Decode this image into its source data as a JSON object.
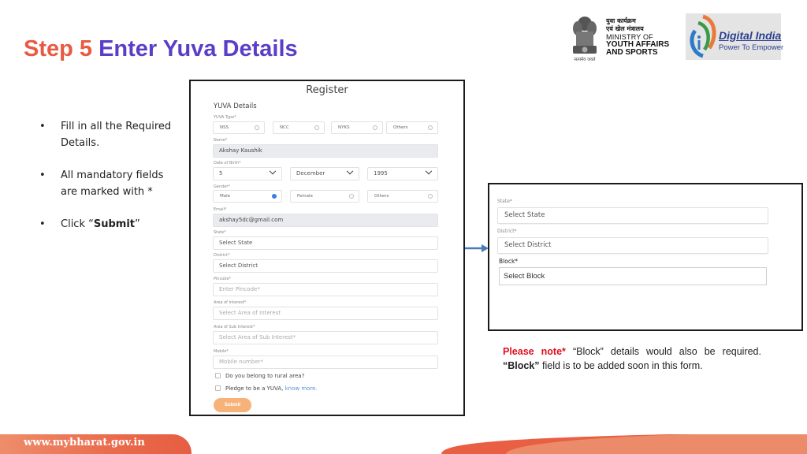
{
  "title": {
    "step": "Step 5",
    "text": "Enter Yuva Details"
  },
  "logos": {
    "ministry": {
      "hindi_line1": "युवा कार्यक्रम",
      "hindi_line2": "एवं खेल मंत्रालय",
      "line3": "MINISTRY OF",
      "line4": "YOUTH AFFAIRS",
      "line5": "AND SPORTS",
      "motto": "सत्यमेव जयते"
    },
    "digital_india": {
      "title": "Digital India",
      "tagline": "Power To Empower"
    }
  },
  "instructions": [
    {
      "text": "Fill in all the Required Details."
    },
    {
      "text": "All mandatory fields are marked with *"
    },
    {
      "prefix": "Click “",
      "bold": "Submit",
      "suffix": "”"
    }
  ],
  "form": {
    "heading": "Register",
    "section": "YUVA Details",
    "yuva_type": {
      "label": "YUVA Type*",
      "options": [
        "NSS",
        "NCC",
        "NYKS",
        "Others"
      ]
    },
    "name": {
      "label": "Name*",
      "value": "Akshay Kaushik"
    },
    "dob": {
      "label": "Date of Birth*",
      "day": "5",
      "month": "December",
      "year": "1995"
    },
    "gender": {
      "label": "Gender*",
      "options": [
        "Male",
        "Female",
        "Others"
      ],
      "selected": "Male"
    },
    "email": {
      "label": "Email*",
      "value": "akshay5dc@gmail.com"
    },
    "state": {
      "label": "State*",
      "value": "Select State"
    },
    "district": {
      "label": "District*",
      "value": "Select District"
    },
    "pincode": {
      "label": "Pincode*",
      "placeholder": "Enter Pincode*"
    },
    "area_of_interest": {
      "label": "Area of Interest*",
      "placeholder": "Select Area of Interest"
    },
    "sub_interest": {
      "label": "Area of Sub Interest*",
      "placeholder": "Select Area of Sub Interest*"
    },
    "mobile": {
      "label": "Mobile*",
      "placeholder": "Mobile number*"
    },
    "rural_checkbox": "Do you belong to rural area?",
    "pledge_checkbox": "Pledge to be a YUVA,",
    "pledge_link": "know more.",
    "submit_label": "Submit"
  },
  "zoom_panel": {
    "state_label": "State*",
    "state_value": "Select State",
    "district_label": "District*",
    "district_value": "Select District",
    "block_label": "Block*",
    "block_value": "Select Block"
  },
  "note": {
    "prefix": "Please note*",
    "part1": " “Block” details would also be required. ",
    "bold": "“Block”",
    "part2": " field is to be added soon in this form."
  },
  "footer": {
    "url": "www.mybharat.gov.in"
  },
  "colors": {
    "step_red": "#e85a41",
    "title_purple": "#5a3ec8",
    "note_red": "#e0101e",
    "submit_orange": "#f7b27a",
    "arrow_blue": "#4a7ab8",
    "footer_orange": "#ea6a4c"
  }
}
